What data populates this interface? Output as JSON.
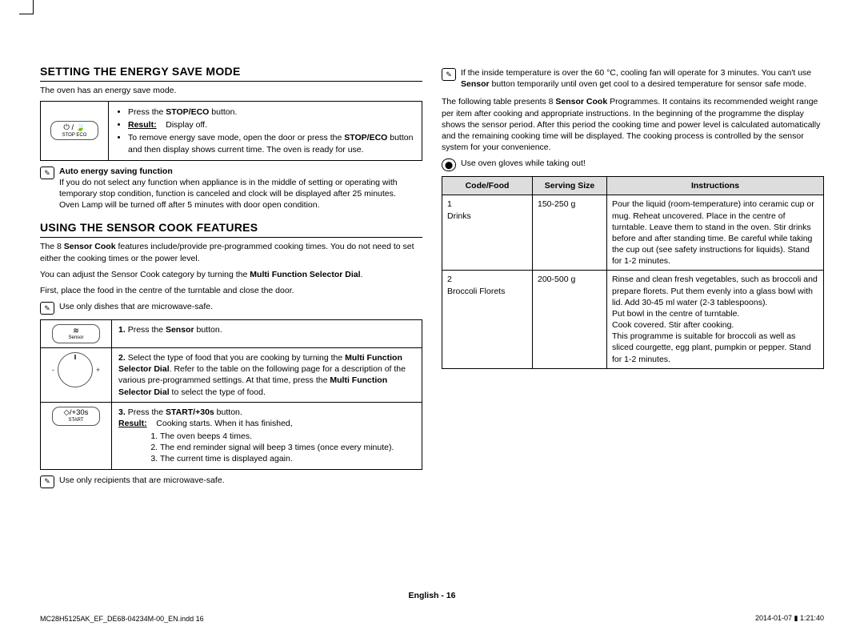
{
  "section1_title": "SETTING THE ENERGY SAVE MODE",
  "s1_intro": "The oven has an energy save mode.",
  "s1_btn_sym": "⏻ / 🍃",
  "s1_btn_label": "STOP  ECO",
  "s1_li1_pre": "Press the ",
  "s1_li1_b": "STOP/ECO",
  "s1_li1_post": " button.",
  "s1_li2_label": "Result:",
  "s1_li2_val": "Display off.",
  "s1_li3_a": "To remove energy save mode, open the door or press the ",
  "s1_li3_b": "STOP/ECO",
  "s1_li3_c": " button and then display shows current time. The oven is ready for use.",
  "s1_note_title": "Auto energy saving function",
  "s1_note_body": "If you do not select any function when appliance is in the middle of setting or operating with temporary stop condition, function is canceled and clock will be displayed after 25 minutes.",
  "s1_note_body2": "Oven Lamp will be turned off after 5 minutes with door open condition.",
  "section2_title": "USING THE SENSOR COOK FEATURES",
  "s2_p1_a": "The 8 ",
  "s2_p1_b": "Sensor Cook",
  "s2_p1_c": " features include/provide pre-programmed cooking times. You do not need to set either the cooking times or the power level.",
  "s2_p2_a": "You can adjust the Sensor Cook category by turning the ",
  "s2_p2_b": "Multi Function Selector Dial",
  "s2_p2_c": ".",
  "s2_p3": "First, place the food in the centre of the turntable and close the door.",
  "s2_note1": "Use only dishes that are microwave-safe.",
  "step1_btn_sym": "≋",
  "step1_btn_label": "Sensor",
  "step1_num": "1.",
  "step1_a": "Press the ",
  "step1_b": "Sensor",
  "step1_c": " button.",
  "step2_num": "2.",
  "step2_a": "Select the type of food that you are cooking by turning the ",
  "step2_b": "Multi Function Selector Dial",
  "step2_c": ". Refer to the table on the following page for a description of the various pre-programmed settings. At that time, press the ",
  "step2_d": "Multi Function Selector Dial",
  "step2_e": " to select the type of food.",
  "step3_btn_sym": "◇/+30s",
  "step3_btn_label": "START",
  "step3_num": "3.",
  "step3_a": "Press the ",
  "step3_b": "START/+30s",
  "step3_c": " button.",
  "step3_res_label": "Result:",
  "step3_res_text": "Cooking starts. When it has finished,",
  "step3_r1": "The oven beeps 4 times.",
  "step3_r2": "The end reminder signal will beep 3 times (once every minute).",
  "step3_r3": "The current time is displayed again.",
  "s2_note2": "Use only recipients that are microwave-safe.",
  "right_note1_a": "If the inside temperature is over the 60 °C, cooling fan will operate for 3 minutes. You can't use ",
  "right_note1_b": "Sensor",
  "right_note1_c": " button temporarily until oven get cool to a desired temperature for sensor safe mode.",
  "right_intro_a": "The following table presents 8 ",
  "right_intro_b": "Sensor Cook",
  "right_intro_c": " Programmes. It contains its recommended weight range per item after cooking and appropriate instructions. In the beginning of the programme the display shows the sensor period. After this period the cooking time and power level is calculated automatically and the remaining cooking time will be displayed. The cooking process is controlled by the sensor system for your convenience.",
  "right_note2": "Use oven gloves while taking out!",
  "th_code": "Code/Food",
  "th_size": "Serving Size",
  "th_instr": "Instructions",
  "row1_code_num": "1",
  "row1_code_name": "Drinks",
  "row1_size": "150-250 g",
  "row1_instr": "Pour the liquid (room-temperature) into ceramic cup or mug. Reheat uncovered. Place in the centre of turntable. Leave them to stand in the oven. Stir drinks before and after standing time. Be careful while taking the cup out (see safety instructions for liquids). Stand for 1-2 minutes.",
  "row2_code_num": "2",
  "row2_code_name": "Broccoli Florets",
  "row2_size": "200-500 g",
  "row2_instr": "Rinse and clean fresh vegetables, such as broccoli and prepare florets. Put them evenly into a glass bowl with lid. Add 30-45 ml water (2-3 tablespoons).\nPut bowl in the centre of turntable.\nCook covered. Stir after cooking.\nThis programme is suitable for broccoli as well as sliced courgette, egg plant, pumpkin or pepper. Stand for 1-2 minutes.",
  "footer_center": "English - 16",
  "footer_left": "MC28H5125AK_EF_DE68-04234M-00_EN.indd   16",
  "footer_right": "2014-01-07   ▮ 1:21:40"
}
